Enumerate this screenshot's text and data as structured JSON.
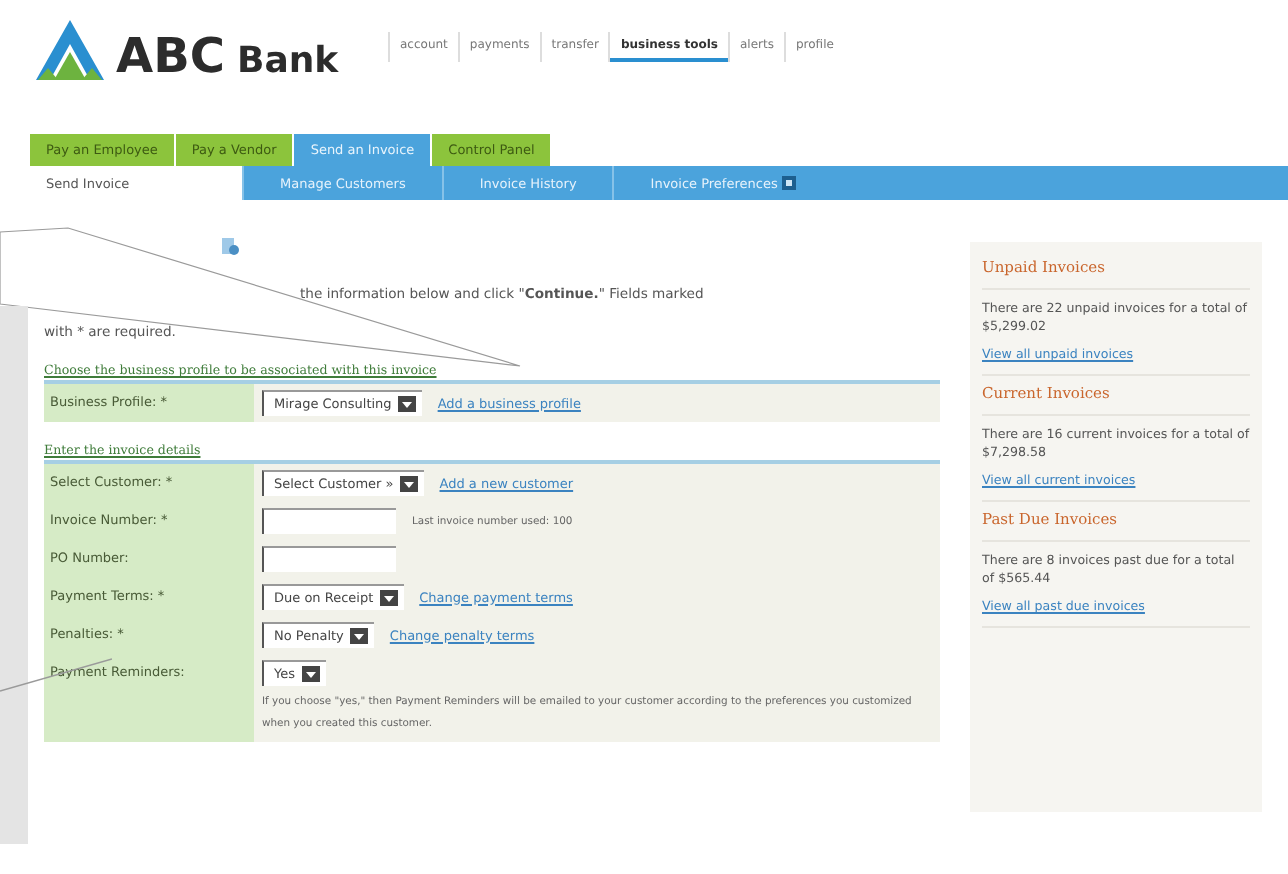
{
  "logo": {
    "name": "ABC",
    "suffix": "Bank"
  },
  "top_nav": [
    {
      "label": "account",
      "selected": false
    },
    {
      "label": "payments",
      "selected": false
    },
    {
      "label": "transfer",
      "selected": false
    },
    {
      "label": "business tools",
      "selected": true
    },
    {
      "label": "alerts",
      "selected": false
    },
    {
      "label": "profile",
      "selected": false
    }
  ],
  "tabs": [
    {
      "label": "Pay an Employee",
      "selected": false
    },
    {
      "label": "Pay a Vendor",
      "selected": false
    },
    {
      "label": "Send an Invoice",
      "selected": true
    },
    {
      "label": "Control Panel",
      "selected": false
    }
  ],
  "subtabs": [
    {
      "label": "Send Invoice",
      "selected": true
    },
    {
      "label": "Manage Customers",
      "selected": false
    },
    {
      "label": "Invoice History",
      "selected": false
    },
    {
      "label": "Invoice Preferences",
      "selected": false
    }
  ],
  "intro": [
    "the information below and click \"**Continue.**\" Fields marked",
    "with * are required."
  ],
  "sections": [
    {
      "heading": "Choose the business profile to be associated with this invoice",
      "rows": [
        {
          "label": "Business Profile: *",
          "kind": "select",
          "value": "Mirage Consulting",
          "link": "Add a business profile"
        }
      ]
    },
    {
      "heading": "Enter the invoice details",
      "rows": [
        {
          "label": "Select Customer: *",
          "kind": "select",
          "value": "Select Customer »",
          "link": "Add a new customer"
        },
        {
          "label": "Invoice Number: *",
          "kind": "input",
          "note": "Last invoice number used: 100"
        },
        {
          "label": "PO Number:",
          "kind": "input"
        },
        {
          "label": "Payment Terms: *",
          "kind": "select",
          "value": "Due on Receipt",
          "link": "Change payment terms"
        },
        {
          "label": "Penalties: *",
          "kind": "select",
          "value": "No Penalty",
          "link": "Change penalty terms"
        },
        {
          "label": "Payment Reminders:",
          "kind": "select",
          "value": "Yes",
          "note": "If you choose \"yes,\" then Payment Reminders will be emailed to your customer according to the preferences you customized when you created this customer."
        }
      ]
    }
  ],
  "sidebar": [
    {
      "title": "Unpaid Invoices",
      "text": "There are 22 unpaid invoices for a total of $5,299.02",
      "link": "View all unpaid invoices"
    },
    {
      "title": "Current Invoices",
      "text": "There are 16 current invoices for a total of $7,298.58",
      "link": "View all current invoices"
    },
    {
      "title": "Past Due Invoices",
      "text": "There are 8 invoices past due for a total of $565.44",
      "link": "View all past due invoices"
    }
  ]
}
